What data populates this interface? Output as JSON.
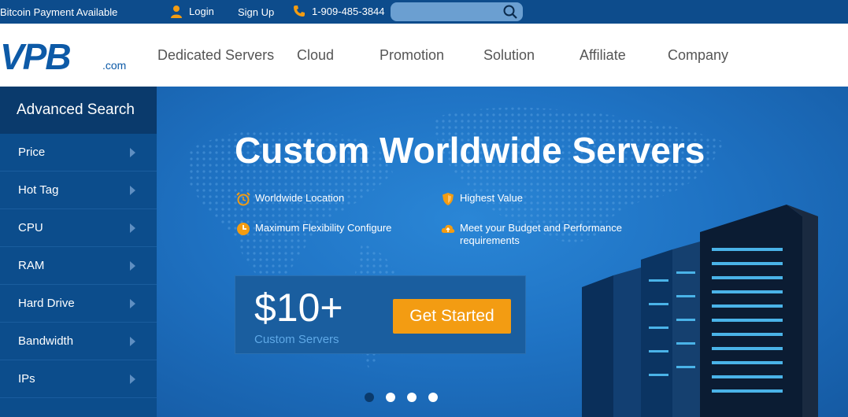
{
  "topbar": {
    "bitcoin": "Bitcoin Payment Available",
    "login": "Login",
    "signup": "Sign Up",
    "phone": "1-909-485-3844",
    "search_placeholder": ""
  },
  "logo": {
    "brand": "VPB",
    "suffix": ".com"
  },
  "nav": [
    {
      "label": "Dedicated Servers"
    },
    {
      "label": "Cloud"
    },
    {
      "label": "Promotion"
    },
    {
      "label": "Solution"
    },
    {
      "label": "Affiliate"
    },
    {
      "label": "Company"
    }
  ],
  "sidebar": {
    "title": "Advanced Search",
    "items": [
      {
        "label": "Price"
      },
      {
        "label": "Hot Tag"
      },
      {
        "label": "CPU"
      },
      {
        "label": "RAM"
      },
      {
        "label": "Hard Drive"
      },
      {
        "label": "Bandwidth"
      },
      {
        "label": "IPs"
      }
    ]
  },
  "hero": {
    "title": "Custom Worldwide Servers",
    "features": [
      {
        "icon": "alarm-clock-icon",
        "text": "Worldwide Location"
      },
      {
        "icon": "shield-icon",
        "text": "Highest Value"
      },
      {
        "icon": "clock-icon",
        "text": "Maximum Flexibility Configure"
      },
      {
        "icon": "cloud-icon",
        "text": "Meet your Budget and Performance requirements"
      }
    ],
    "price": "$10+",
    "price_sub": "Custom Servers",
    "cta": "Get Started",
    "slides": 4,
    "active_slide": 1
  },
  "colors": {
    "topbar": "#0d4c8c",
    "sidebar": "#0c4d8c",
    "accent": "#f39c12",
    "hero": "#1f73c4"
  }
}
